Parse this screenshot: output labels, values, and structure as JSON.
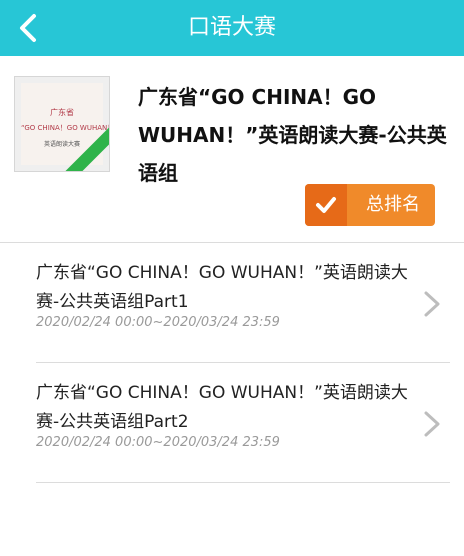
{
  "header": {
    "title": "口语大赛",
    "back_icon": "chevron-left-icon"
  },
  "contest": {
    "title": "广东省“GO CHINA！GO WUHAN！”英语朗读大赛-公共英语组",
    "cover": {
      "line1": "广东省",
      "line2": "“GO CHINA！GO WUHAN！”",
      "line3": "英语朗读大赛"
    },
    "rank_button": {
      "label": "总排名",
      "icon": "check-icon"
    }
  },
  "items": [
    {
      "name": "广东省“GO CHINA！GO WUHAN！”英语朗读大赛-公共英语组Part1",
      "time": "2020/02/24 00:00~2020/03/24 23:59"
    },
    {
      "name": "广东省“GO CHINA！GO WUHAN！”英语朗读大赛-公共英语组Part2",
      "time": "2020/02/24 00:00~2020/03/24 23:59"
    }
  ],
  "colors": {
    "topbar": "#27c6d6",
    "rank_button": "#f08a2a",
    "rank_button_dark": "#e66a18"
  }
}
